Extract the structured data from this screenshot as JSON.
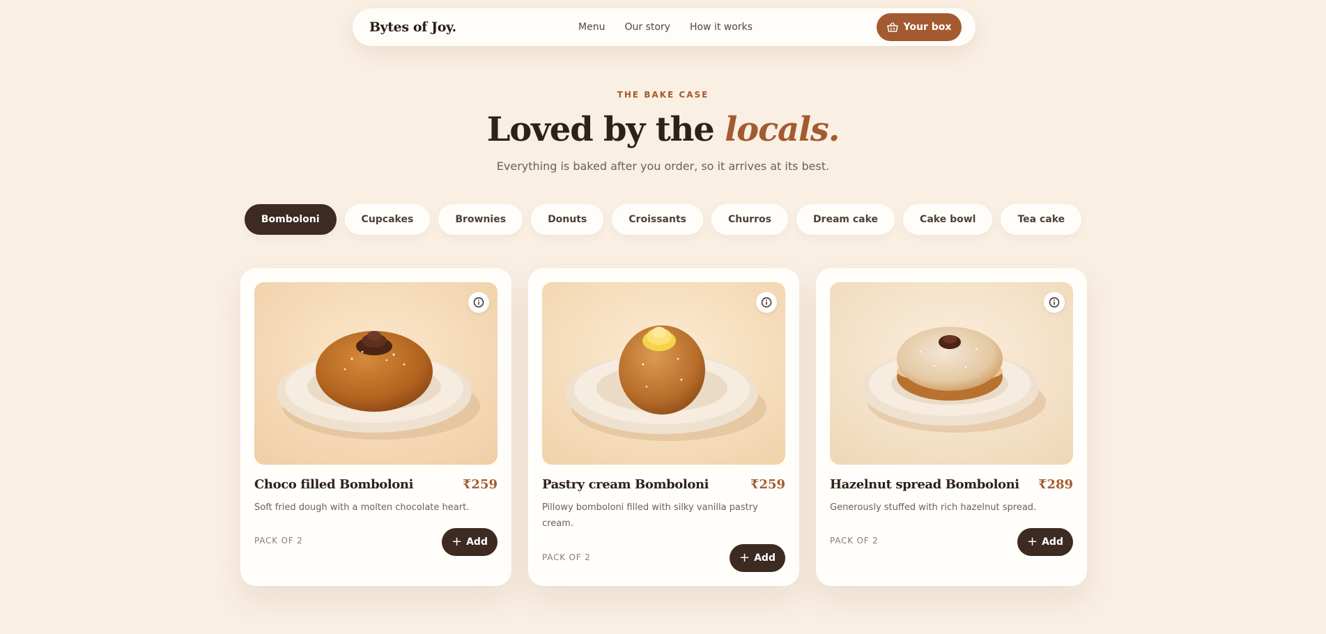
{
  "nav": {
    "brand": "Bytes of Joy.",
    "links": [
      "Menu",
      "Our story",
      "How it works"
    ],
    "cart_label": "Your box",
    "cart_icon": "basket-icon"
  },
  "hero": {
    "eyebrow": "THE BAKE CASE",
    "headline_main": "Loved by the ",
    "headline_accent": "locals.",
    "subhead": "Everything is baked after you order, so it arrives at its best."
  },
  "filters": {
    "active": "Bomboloni",
    "items": [
      "Bomboloni",
      "Cupcakes",
      "Brownies",
      "Donuts",
      "Croissants",
      "Churros",
      "Dream cake",
      "Cake bowl",
      "Tea cake"
    ]
  },
  "products": [
    {
      "name": "Choco filled Bomboloni",
      "price": "₹259",
      "description": "Soft fried dough with a molten chocolate heart.",
      "pack": "PACK OF 2",
      "add_label": "Add",
      "image": "bomboloni-chocolate-swirl"
    },
    {
      "name": "Pastry cream Bomboloni",
      "price": "₹259",
      "description": "Pillowy bomboloni filled with silky vanilla pastry cream.",
      "pack": "PACK OF 2",
      "add_label": "Add",
      "image": "bomboloni-vanilla-cream"
    },
    {
      "name": "Hazelnut spread Bomboloni",
      "price": "₹289",
      "description": "Generously stuffed with rich hazelnut spread.",
      "pack": "PACK OF 2",
      "add_label": "Add",
      "image": "bomboloni-hazelnut-sugar"
    }
  ],
  "colors": {
    "background": "#f9efe3",
    "accent": "#a45a30",
    "dark": "#3d2a20",
    "card": "#fffefb"
  },
  "icons": {
    "info": "info-icon",
    "add": "plus-icon"
  }
}
